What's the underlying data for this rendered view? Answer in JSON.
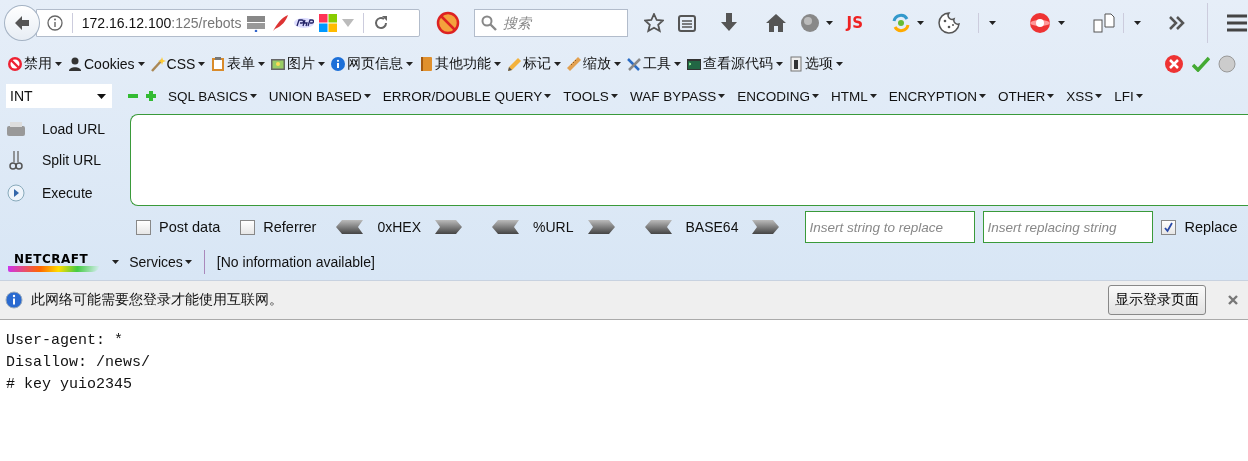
{
  "address_bar": {
    "host": "172.16.12.100",
    "path": ":125/rebots"
  },
  "search": {
    "placeholder": "搜索"
  },
  "nav_toolbar": {
    "js_label": "JS"
  },
  "web_developer": {
    "menus": [
      {
        "label": "禁用",
        "has_menu": true
      },
      {
        "label": "Cookies",
        "has_menu": true
      },
      {
        "label": "CSS",
        "has_menu": true
      },
      {
        "label": "表单",
        "has_menu": true
      },
      {
        "label": "图片",
        "has_menu": true
      },
      {
        "label": "网页信息",
        "has_menu": true
      },
      {
        "label": "其他功能",
        "has_menu": true
      },
      {
        "label": "标记",
        "has_menu": true
      },
      {
        "label": "缩放",
        "has_menu": true
      },
      {
        "label": "工具",
        "has_menu": true
      },
      {
        "label": "查看源代码",
        "has_menu": true
      },
      {
        "label": "选项",
        "has_menu": true
      }
    ]
  },
  "hackbar": {
    "encoding_select": "INT",
    "menus": [
      {
        "label": "SQL BASICS",
        "has_menu": true
      },
      {
        "label": "UNION BASED",
        "has_menu": true
      },
      {
        "label": "ERROR/DOUBLE QUERY",
        "has_menu": true
      },
      {
        "label": "TOOLS",
        "has_menu": true
      },
      {
        "label": "WAF BYPASS",
        "has_menu": true
      },
      {
        "label": "ENCODING",
        "has_menu": true
      },
      {
        "label": "HTML",
        "has_menu": true
      },
      {
        "label": "ENCRYPTION",
        "has_menu": true
      },
      {
        "label": "OTHER",
        "has_menu": true
      },
      {
        "label": "XSS",
        "has_menu": true
      },
      {
        "label": "LFI",
        "has_menu": true
      }
    ],
    "actions": [
      "Load URL",
      "Split URL",
      "Execute"
    ],
    "post_data": {
      "label": "Post data",
      "checked": false
    },
    "referrer": {
      "label": "Referrer",
      "checked": false
    },
    "encoders": [
      "0xHEX",
      "%URL",
      "BASE64"
    ],
    "find_field": {
      "placeholder": "Insert string to replace"
    },
    "replace_field": {
      "placeholder": "Insert replacing string"
    },
    "replace_all": {
      "label": "Replace",
      "checked": true
    }
  },
  "netcraft": {
    "logo": "NETCRAFT",
    "services": "Services",
    "info": "[No information available]"
  },
  "notification": {
    "message": "此网络可能需要您登录才能使用互联网。",
    "button": "显示登录页面"
  },
  "page_text": [
    "User-agent: *",
    "Disallow: /news/",
    "# key yuio2345"
  ]
}
